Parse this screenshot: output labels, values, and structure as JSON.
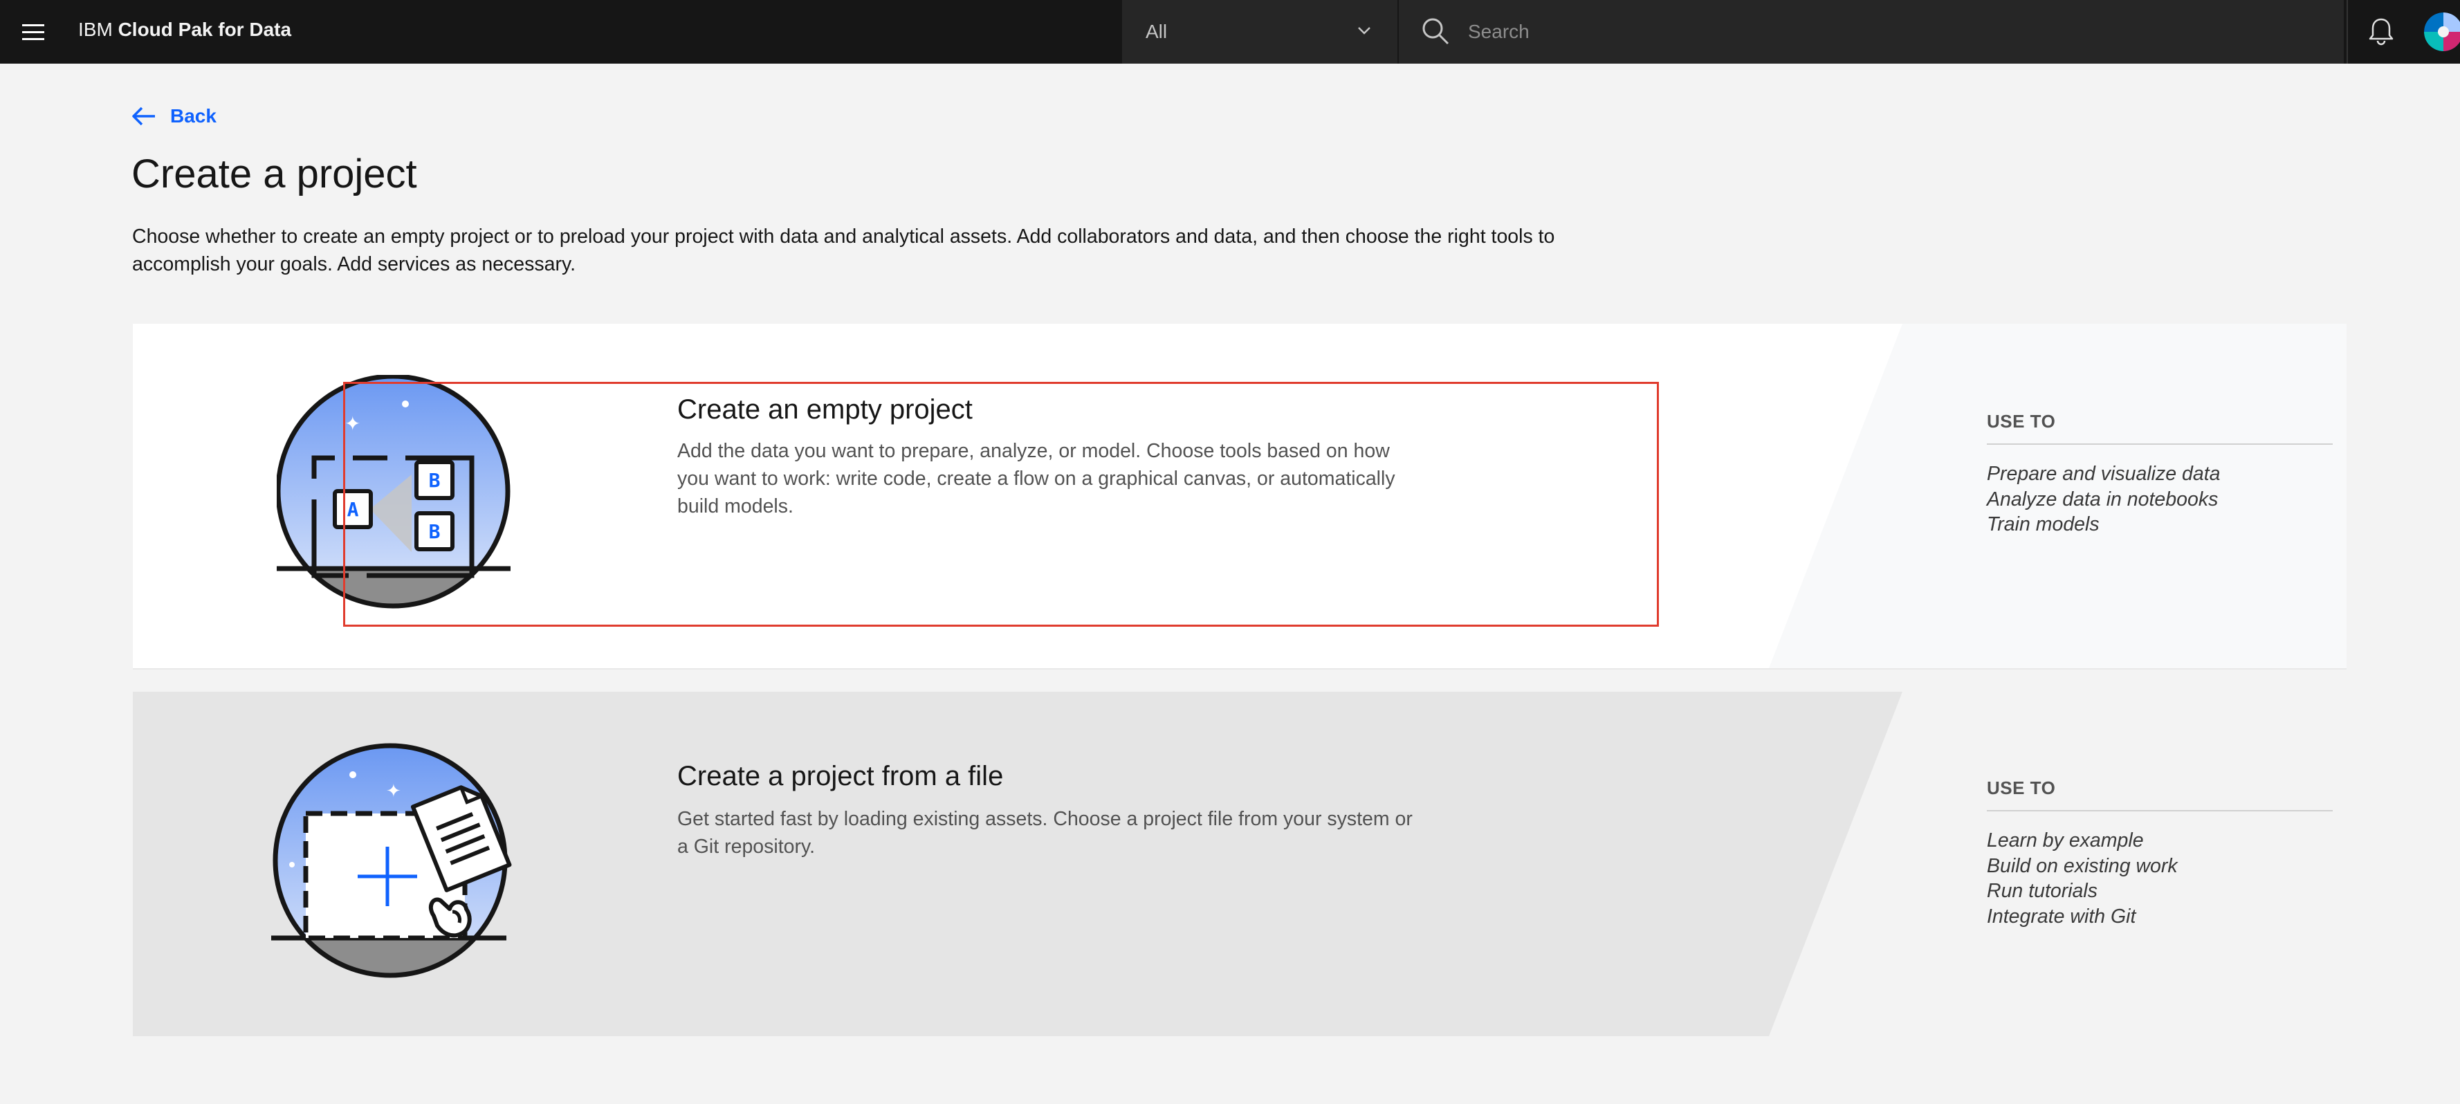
{
  "header": {
    "brand_prefix": "IBM",
    "brand_name": "Cloud Pak for Data",
    "scope_value": "All",
    "search_placeholder": "Search"
  },
  "back_label": "Back",
  "page": {
    "title": "Create a project",
    "description": "Choose whether to create an empty project or to preload your project with data and analytical assets. Add collaborators and data, and then choose the right tools to accomplish your goals. Add services as necessary."
  },
  "cards": [
    {
      "title": "Create an empty project",
      "description": "Add the data you want to prepare, analyze, or model. Choose tools based on how you want to work: write code, create a flow on a graphical canvas, or automatically build models.",
      "use_to_label": "USE TO",
      "use_to": [
        "Prepare and visualize data",
        "Analyze data in notebooks",
        "Train models"
      ],
      "illustration_letters": [
        "A",
        "B",
        "B"
      ]
    },
    {
      "title": "Create a project from a file",
      "description": "Get started fast by loading existing assets. Choose a project file from your system or a Git repository.",
      "use_to_label": "USE TO",
      "use_to": [
        "Learn by example",
        "Build on existing work",
        "Run tutorials",
        "Integrate with Git"
      ]
    }
  ],
  "colors": {
    "header_bg": "#161616",
    "accent_blue": "#0f62fe",
    "highlight_red": "#e03c2e",
    "page_bg": "#f3f3f3"
  },
  "icons": {
    "menu": "hamburger-menu-icon",
    "scope_chevron": "chevron-down-icon",
    "search": "search-icon",
    "notification": "notification-bell-icon",
    "back": "arrow-left-icon"
  }
}
